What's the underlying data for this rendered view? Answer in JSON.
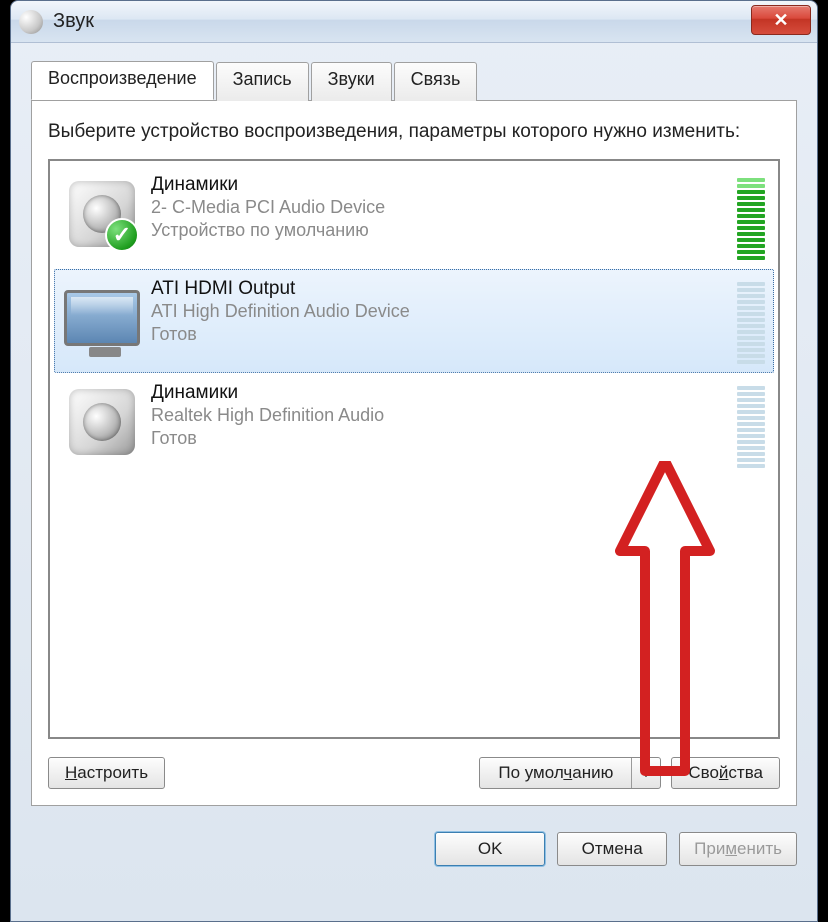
{
  "window": {
    "title": "Звук"
  },
  "tabs": {
    "playback": "Воспроизведение",
    "recording": "Запись",
    "sounds": "Звуки",
    "communications": "Связь"
  },
  "instruction": "Выберите устройство воспроизведения, параметры которого нужно изменить:",
  "devices": [
    {
      "name": "Динамики",
      "driver": "2- C-Media PCI Audio Device",
      "status": "Устройство по умолчанию",
      "icon": "speaker",
      "default": true,
      "selected": false,
      "meter": "green"
    },
    {
      "name": "ATI HDMI Output",
      "driver": "ATI High Definition Audio Device",
      "status": "Готов",
      "icon": "monitor",
      "default": false,
      "selected": true,
      "meter": "faint"
    },
    {
      "name": "Динамики",
      "driver": "Realtek High Definition Audio",
      "status": "Готов",
      "icon": "speaker",
      "default": false,
      "selected": false,
      "meter": "faint"
    }
  ],
  "buttons": {
    "configure": "Настроить",
    "set_default": "По умолчанию",
    "properties": "Свойства",
    "ok": "OK",
    "cancel": "Отмена",
    "apply": "Применить"
  },
  "annotation": {
    "arrow_color": "#d32121"
  }
}
